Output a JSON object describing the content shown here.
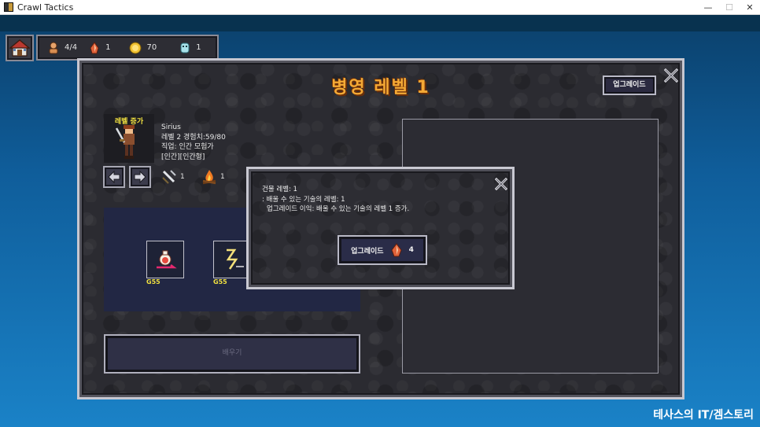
{
  "window": {
    "title": "Crawl Tactics",
    "controls": {
      "minimize": "—",
      "maximize": "☐",
      "close": "✕"
    }
  },
  "resources": [
    {
      "icon": "person-icon",
      "value": "4/4"
    },
    {
      "icon": "crystal-icon",
      "value": "1"
    },
    {
      "icon": "gold-coin-icon",
      "value": "70"
    },
    {
      "icon": "blue-token-icon",
      "value": "1"
    }
  ],
  "panel": {
    "title": "병영 레벨 1",
    "upgrade_label": "업그레이드"
  },
  "hero": {
    "level_up_label": "레벨 증가",
    "name": "Sirius",
    "level_exp": "레벨 2 경험치:59/80",
    "job": "직업: 인간 모험가",
    "tags": "[인간][인간형]",
    "attack": "1",
    "fire": "1"
  },
  "skills": [
    {
      "icon": "potion-skill-icon",
      "price": "G55"
    },
    {
      "icon": "lightning-skill-icon",
      "price": "G55"
    }
  ],
  "learn_label": "배우기",
  "dialog": {
    "line1": "건물 레벨: 1",
    "line2": ": 배울 수 있는 기술의 레벨: 1",
    "line3": "업그레이드 이익: 배울 수 있는 기술의 레벨 1 증가.",
    "upgrade_label": "업그레이드",
    "cost": "4"
  },
  "watermark": "테사스의 IT/겜스토리",
  "colors": {
    "title_orange": "#f4a935",
    "price_yellow": "#f0e040"
  }
}
